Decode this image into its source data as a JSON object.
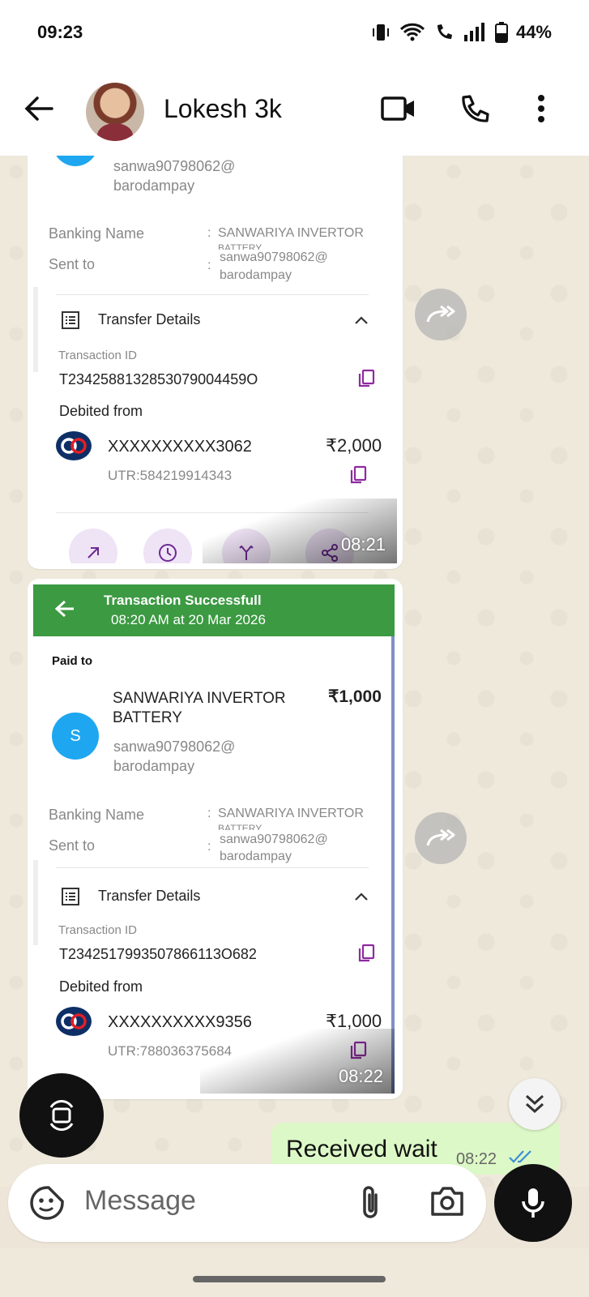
{
  "status": {
    "time": "09:23",
    "battery": "44%"
  },
  "header": {
    "contact_name": "Lokesh 3k"
  },
  "msg1": {
    "upi_line1": "sanwa90798062@",
    "upi_line2": "barodampay",
    "banking_name_label": "Banking Name",
    "banking_name_value": "SANWARIYA INVERTOR",
    "banking_name_cut": "BATTERY",
    "sent_to_label": "Sent to",
    "sent_to_line1": "sanwa90798062@",
    "sent_to_line2": "barodampay",
    "transfer_details": "Transfer Details",
    "txn_label": "Transaction ID",
    "txn_id": "T2342588132853079004459O",
    "debited_label": "Debited from",
    "account": "XXXXXXXXXX3062",
    "amount": "₹2,000",
    "utr": "UTR:584219914343",
    "time": "08:21"
  },
  "msg2": {
    "title": "Transaction Successfull",
    "subtitle": "08:20 AM at 20 Mar 2026",
    "paid_to": "Paid to",
    "payee_line1": "SANWARIYA INVERTOR",
    "payee_line2": "BATTERY",
    "amount": "₹1,000",
    "avatar_letter": "S",
    "upi_line1": "sanwa90798062@",
    "upi_line2": "barodampay",
    "banking_name_label": "Banking Name",
    "banking_name_value": "SANWARIYA INVERTOR",
    "banking_name_cut": "BATTERY",
    "sent_to_label": "Sent to",
    "sent_to_line1": "sanwa90798062@",
    "sent_to_line2": "barodampay",
    "transfer_details": "Transfer Details",
    "txn_label": "Transaction ID",
    "txn_id": "T2342517993507866113O682",
    "debited_label": "Debited from",
    "account": "XXXXXXXXXX9356",
    "debit_amount": "₹1,000",
    "utr": "UTR:788036375684",
    "time": "08:22"
  },
  "msg3": {
    "text": "Received wait",
    "time": "08:22"
  },
  "composer": {
    "placeholder": "Message"
  },
  "colors": {
    "accent_green": "#3c9a42",
    "outgoing_bubble": "#dcf8c6",
    "copy_purple": "#8e2ba0",
    "read_tick": "#3b8fd6"
  }
}
